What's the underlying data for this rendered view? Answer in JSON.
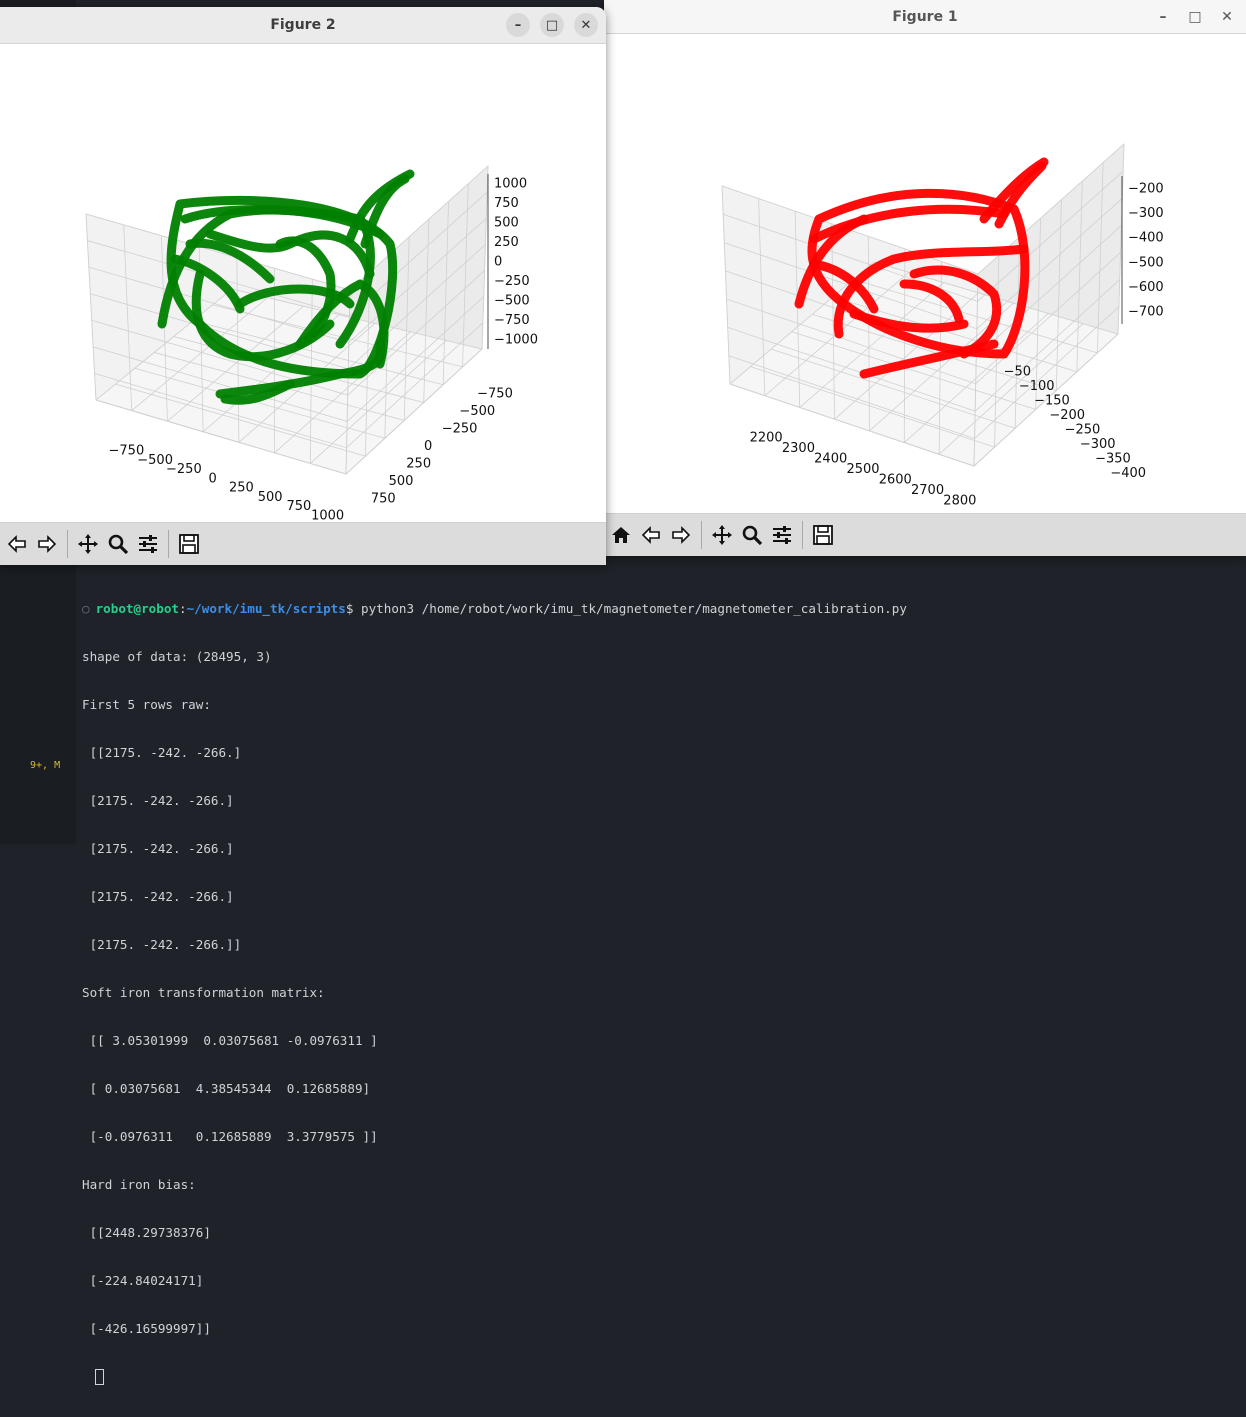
{
  "terminal": {
    "gutter_badge": "9+, M",
    "prompt_user": "robot@robot",
    "prompt_path": "~/work/imu_tk/scripts",
    "prompt_symbol": "$",
    "command": " python3 /home/robot/work/imu_tk/magnetometer/magnetometer_calibration.py",
    "output_lines": [
      "shape of data: (28495, 3)",
      "First 5 rows raw:",
      " [[2175. -242. -266.]",
      " [2175. -242. -266.]",
      " [2175. -242. -266.]",
      " [2175. -242. -266.]",
      " [2175. -242. -266.]]",
      "Soft iron transformation matrix:",
      " [[ 3.05301999  0.03075681 -0.0976311 ]",
      " [ 0.03075681  4.38545344  0.12685889]",
      " [-0.0976311   0.12685889  3.3779575 ]]",
      "Hard iron bias:",
      " [[2448.29738376]",
      " [-224.84024171]",
      " [-426.16599997]]"
    ]
  },
  "windows": {
    "figure2": {
      "title": "Figure 2",
      "buttons": [
        "–",
        "□",
        "✕"
      ],
      "toolbar": [
        "back",
        "forward",
        "pan",
        "zoom",
        "configure",
        "save"
      ]
    },
    "figure1": {
      "title": "Figure 1",
      "buttons": [
        "–",
        "□",
        "✕"
      ],
      "toolbar": [
        "home",
        "back",
        "forward",
        "pan",
        "zoom",
        "configure",
        "save"
      ]
    }
  },
  "chart_data": [
    {
      "type": "scatter",
      "title": "",
      "color": "#008000",
      "x_ticks": [
        "−750",
        "−500",
        "−250",
        "0",
        "250",
        "500",
        "750",
        "1000"
      ],
      "y_ticks": [
        "750",
        "500",
        "250",
        "0",
        "−250",
        "−500",
        "−750"
      ],
      "z_ticks": [
        "1000",
        "750",
        "500",
        "250",
        "0",
        "−250",
        "−500",
        "−750",
        "−1000"
      ]
    },
    {
      "type": "scatter",
      "title": "",
      "color": "#ff0000",
      "x_ticks": [
        "2200",
        "2300",
        "2400",
        "2500",
        "2600",
        "2700",
        "2800"
      ],
      "y_ticks": [
        "−50",
        "−100",
        "−150",
        "−200",
        "−250",
        "−300",
        "−350",
        "−400"
      ],
      "z_ticks": [
        "−200",
        "−300",
        "−400",
        "−500",
        "−600",
        "−700"
      ]
    }
  ]
}
